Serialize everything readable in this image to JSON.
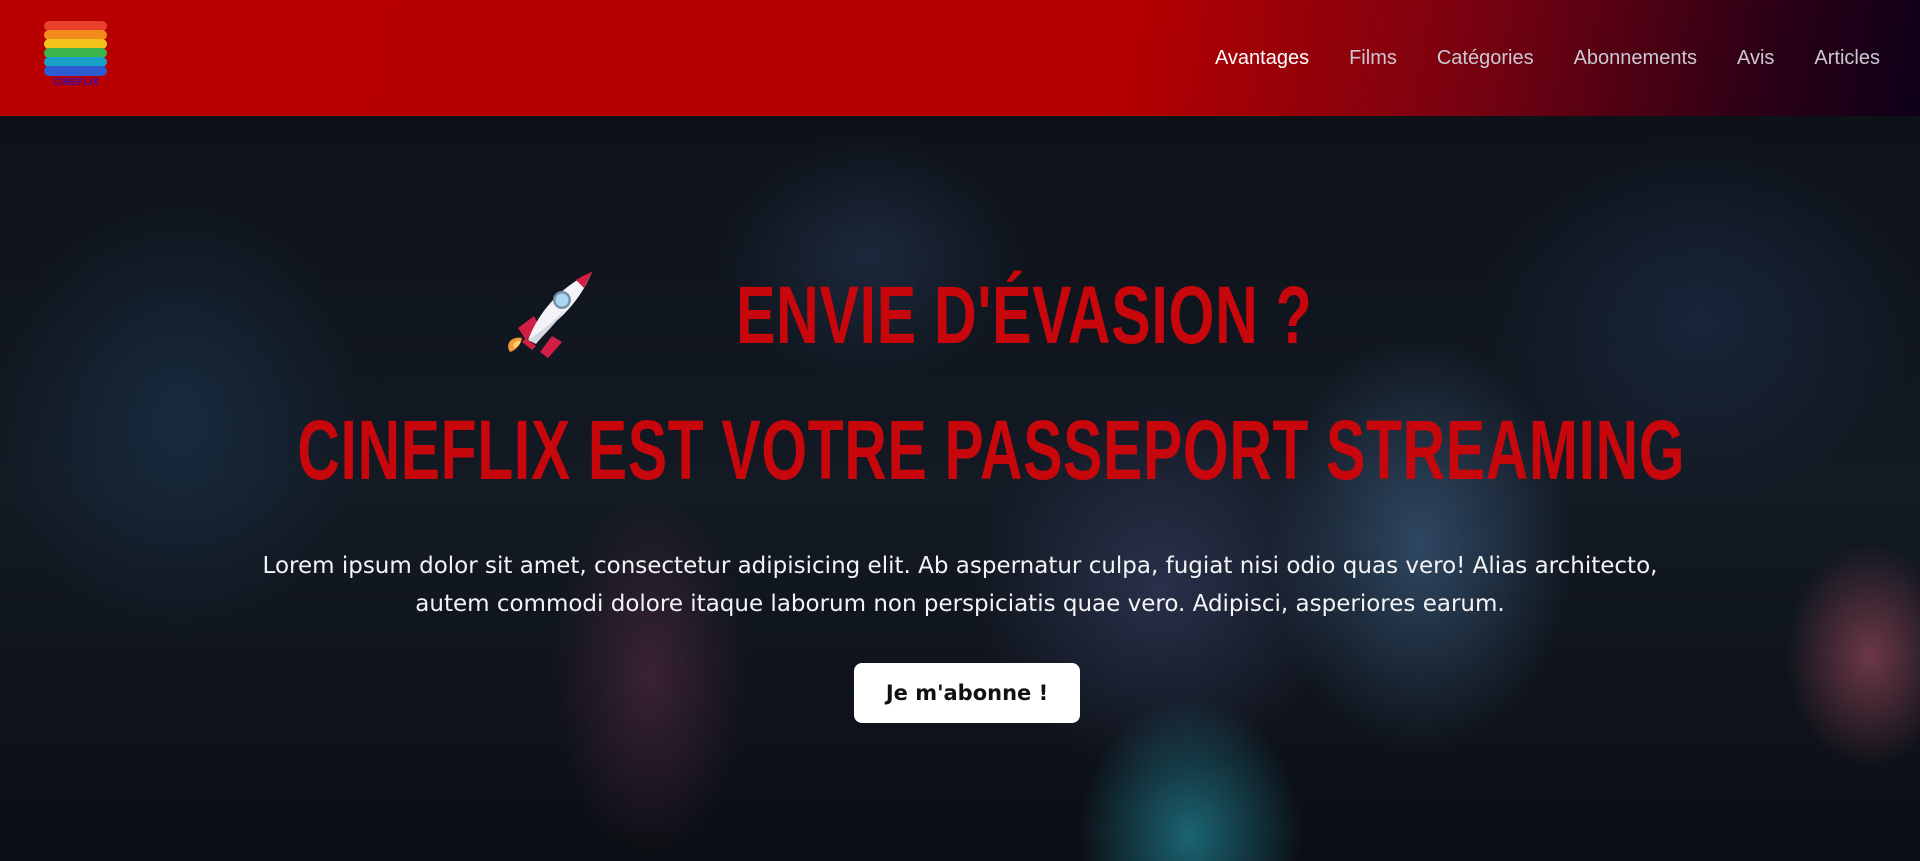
{
  "brand": {
    "logo_text": "CINEFLIX",
    "stripe_colors": [
      "#e8402a",
      "#f38a1c",
      "#f2c21b",
      "#3bb54a",
      "#19a0c8",
      "#2d5bd1"
    ],
    "primary_red": "#c8070c"
  },
  "nav": {
    "items": [
      {
        "label": "Avantages",
        "active": true
      },
      {
        "label": "Films",
        "active": false
      },
      {
        "label": "Catégories",
        "active": false
      },
      {
        "label": "Abonnements",
        "active": false
      },
      {
        "label": "Avis",
        "active": false
      },
      {
        "label": "Articles",
        "active": false
      }
    ]
  },
  "hero": {
    "icon": "rocket-icon",
    "headline_line1": "ENVIE D'ÉVASION ?",
    "headline_line2": "CINEFLIX EST VOTRE PASSEPORT STREAMING",
    "description_line1": "Lorem ipsum dolor sit amet, consectetur adipisicing elit. Ab aspernatur culpa, fugiat nisi odio quas vero! Alias architecto,",
    "description_line2": "autem commodi dolore itaque laborum non perspiciatis quae vero. Adipisci, asperiores earum.",
    "cta_label": "Je m'abonne !"
  }
}
